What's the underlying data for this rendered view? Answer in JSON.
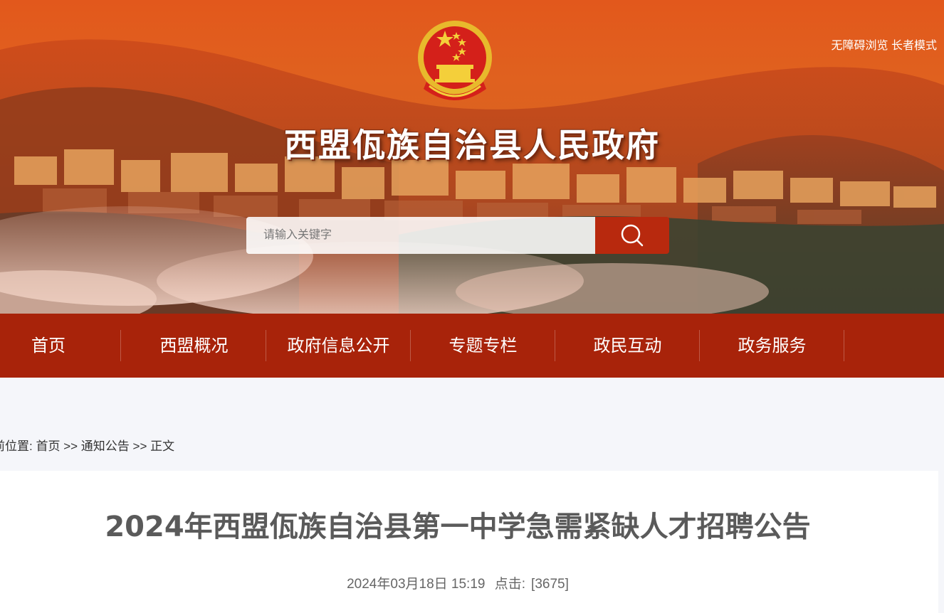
{
  "header": {
    "accessibility_links": [
      "无障碍浏览",
      "长者模式"
    ],
    "site_title": "西盟佤族自治县人民政府",
    "emblem_icon": "national-emblem-icon",
    "search": {
      "placeholder": "请输入关键字",
      "value": "",
      "button_icon": "search-icon"
    }
  },
  "nav": {
    "items": [
      "首页",
      "西盟概况",
      "政府信息公开",
      "专题专栏",
      "政民互动",
      "政务服务"
    ]
  },
  "breadcrumb": {
    "prefix": "前位置:",
    "items": [
      "首页",
      "通知公告",
      "正文"
    ],
    "separator": ">>"
  },
  "article": {
    "title": "2024年西盟佤族自治县第一中学急需紧缺人才招聘公告",
    "date": "2024年03月18日 15:19",
    "clicks_label": "点击:",
    "clicks_value": "[3675]"
  },
  "colors": {
    "banner_orange": "#e2581c",
    "nav_red": "#a8230a",
    "search_button": "#b8290e",
    "page_bg": "#f5f6fa"
  }
}
